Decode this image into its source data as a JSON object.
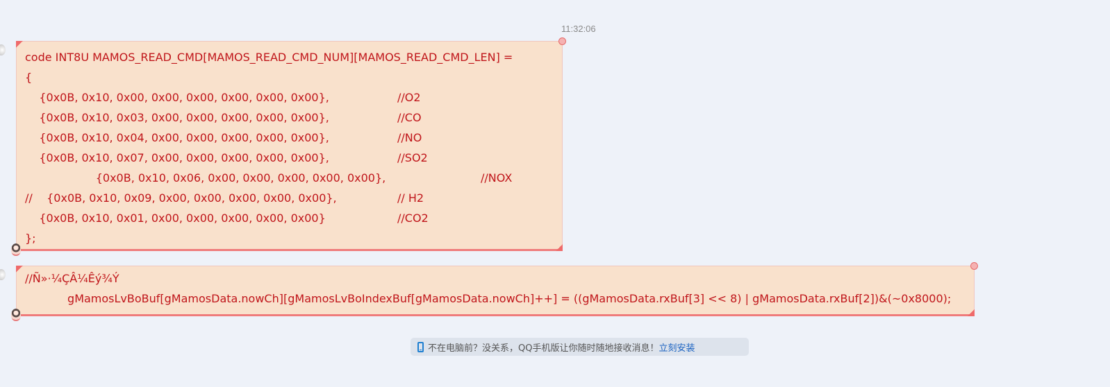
{
  "chat": {
    "timestamp": "11:32:06",
    "message1": {
      "lines": [
        "code INT8U MAMOS_READ_CMD[MAMOS_READ_CMD_NUM][MAMOS_READ_CMD_LEN] =",
        "{",
        "    {0x0B, 0x10, 0x00, 0x00, 0x00, 0x00, 0x00, 0x00},",
        "    {0x0B, 0x10, 0x03, 0x00, 0x00, 0x00, 0x00, 0x00},",
        "    {0x0B, 0x10, 0x04, 0x00, 0x00, 0x00, 0x00, 0x00},",
        "    {0x0B, 0x10, 0x07, 0x00, 0x00, 0x00, 0x00, 0x00},",
        "                    {0x0B, 0x10, 0x06, 0x00, 0x00, 0x00, 0x00, 0x00},",
        "//    {0x0B, 0x10, 0x09, 0x00, 0x00, 0x00, 0x00, 0x00},",
        "    {0x0B, 0x10, 0x01, 0x00, 0x00, 0x00, 0x00, 0x00}",
        "};"
      ],
      "comments": [
        "",
        "",
        "//O2",
        "//CO",
        "//NO",
        "//SO2",
        "//NOX",
        "// H2",
        "//CO2",
        ""
      ]
    },
    "message2": {
      "line1": "//Ñ»·¼ÇÂ¼Êý¾Ý",
      "line2": "            gMamosLvBoBuf[gMamosData.nowCh][gMamosLvBoIndexBuf[gMamosData.nowCh]++] = ((gMamosData.rxBuf[3] << 8) | gMamosData.rxBuf[2])&(~0x8000);"
    },
    "notice": {
      "text": "不在电脑前？没关系，QQ手机版让你随时随地接收消息！",
      "link": "立刻安装"
    }
  }
}
